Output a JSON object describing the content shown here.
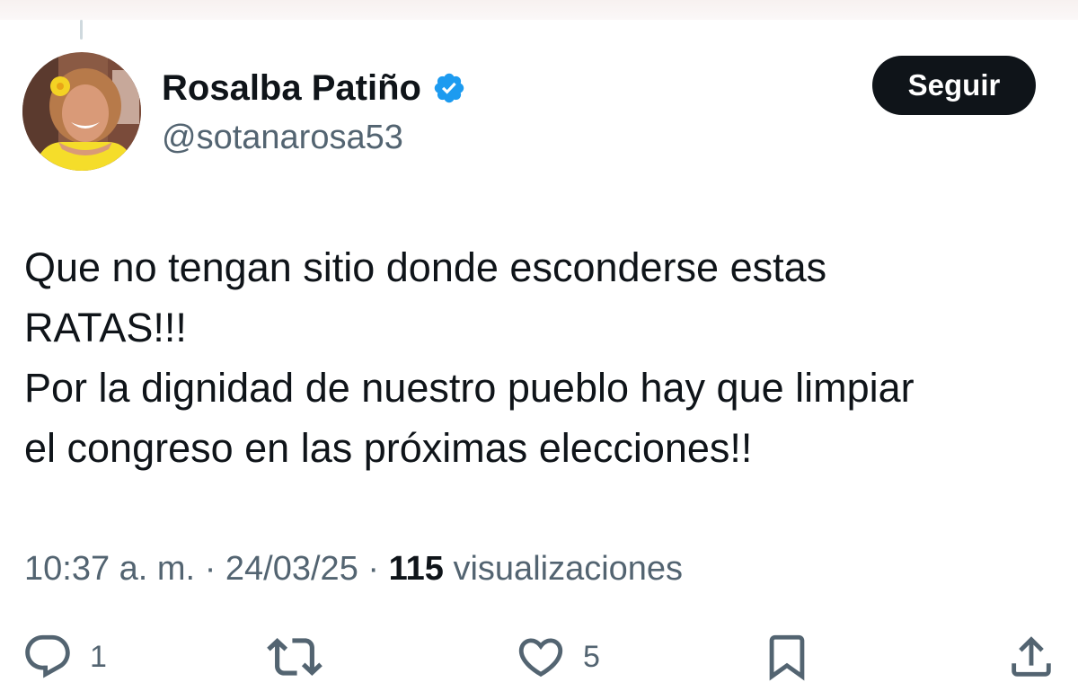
{
  "tweet": {
    "author": {
      "display_name": "Rosalba Patiño",
      "handle": "@sotanarosa53",
      "verified": true
    },
    "follow_button_label": "Seguir",
    "text": "Que no tengan sitio donde esconderse estas\nRATAS!!!\nPor la dignidad de nuestro pueblo hay que limpiar\nel congreso en las próximas elecciones!!",
    "time": "10:37 a. m.",
    "separator": "·",
    "date": "24/03/25",
    "views_count": "115",
    "views_label": "visualizaciones"
  },
  "actions": {
    "reply": {
      "icon": "reply-icon",
      "count": "1"
    },
    "retweet": {
      "icon": "retweet-icon",
      "count": ""
    },
    "like": {
      "icon": "heart-icon",
      "count": "5"
    },
    "bookmark": {
      "icon": "bookmark-icon"
    },
    "share": {
      "icon": "share-icon"
    }
  },
  "colors": {
    "text_primary": "#0f1419",
    "text_secondary": "#536471",
    "verified_blue": "#1d9bf0",
    "button_bg": "#0f1419",
    "button_text": "#ffffff"
  }
}
